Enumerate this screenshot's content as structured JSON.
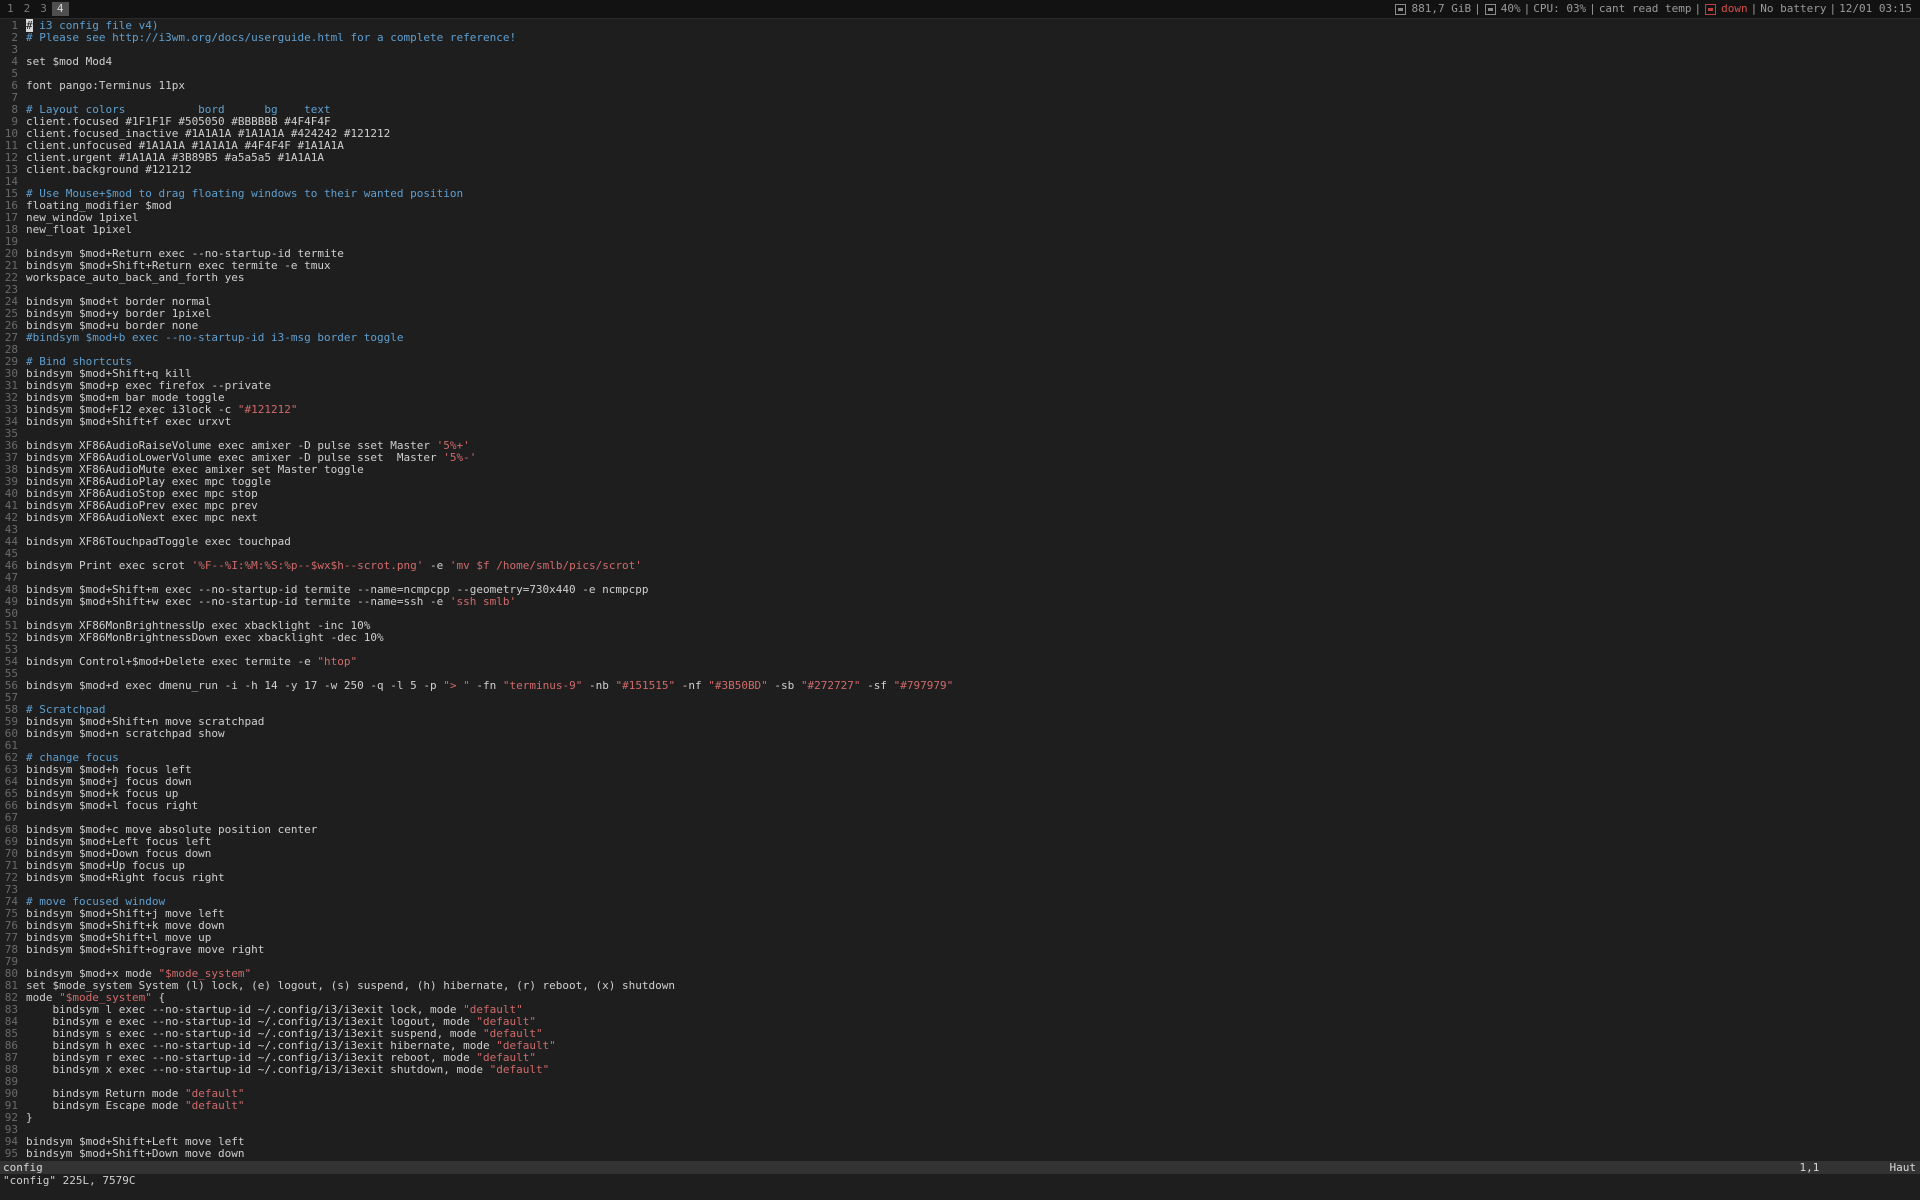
{
  "topbar": {
    "workspaces": [
      "1",
      "2",
      "3",
      "4"
    ],
    "focused_workspace": "4",
    "disk": "881,7 GiB",
    "volume": "40%",
    "cpu": "CPU: 03%",
    "temp": "cant read temp",
    "net": "down",
    "battery": "No battery",
    "datetime": "12/01 03:15",
    "icons": [
      "disk-icon",
      "volume-icon",
      "network-icon"
    ]
  },
  "editor": {
    "lines": [
      [
        {
          "t": "# i3 config file v4)",
          "c": "comment"
        }
      ],
      [
        {
          "t": "# Please see http://i3wm.org/docs/userguide.html for a complete reference!",
          "c": "comment"
        }
      ],
      [],
      [
        {
          "t": "set $mod Mod4"
        }
      ],
      [],
      [
        {
          "t": "font pango:Terminus 11px"
        }
      ],
      [],
      [
        {
          "t": "# Layout colors           bord      bg    text",
          "c": "comment"
        }
      ],
      [
        {
          "t": "client.focused #1F1F1F #505050 #BBBBBB #4F4F4F"
        }
      ],
      [
        {
          "t": "client.focused_inactive #1A1A1A #1A1A1A #424242 #121212"
        }
      ],
      [
        {
          "t": "client.unfocused #1A1A1A #1A1A1A #4F4F4F #1A1A1A"
        }
      ],
      [
        {
          "t": "client.urgent #1A1A1A #3B89B5 #a5a5a5 #1A1A1A"
        }
      ],
      [
        {
          "t": "client.background #121212"
        }
      ],
      [],
      [
        {
          "t": "# Use Mouse+$mod to drag floating windows to their wanted position",
          "c": "comment"
        }
      ],
      [
        {
          "t": "floating_modifier $mod"
        }
      ],
      [
        {
          "t": "new_window 1pixel"
        }
      ],
      [
        {
          "t": "new_float 1pixel"
        }
      ],
      [],
      [
        {
          "t": "bindsym $mod+Return exec --no-startup-id termite"
        }
      ],
      [
        {
          "t": "bindsym $mod+Shift+Return exec termite -e tmux"
        }
      ],
      [
        {
          "t": "workspace_auto_back_and_forth yes"
        }
      ],
      [],
      [
        {
          "t": "bindsym $mod+t border normal"
        }
      ],
      [
        {
          "t": "bindsym $mod+y border 1pixel"
        }
      ],
      [
        {
          "t": "bindsym $mod+u border none"
        }
      ],
      [
        {
          "t": "#bindsym $mod+b exec --no-startup-id i3-msg border toggle",
          "c": "comment"
        }
      ],
      [],
      [
        {
          "t": "# Bind shortcuts",
          "c": "comment"
        }
      ],
      [
        {
          "t": "bindsym $mod+Shift+q kill"
        }
      ],
      [
        {
          "t": "bindsym $mod+p exec firefox --private"
        }
      ],
      [
        {
          "t": "bindsym $mod+m bar mode toggle"
        }
      ],
      [
        {
          "t": "bindsym $mod+F12 exec i3lock -c "
        },
        {
          "t": "\"#121212\"",
          "c": "str"
        }
      ],
      [
        {
          "t": "bindsym $mod+Shift+f exec urxvt"
        }
      ],
      [],
      [
        {
          "t": "bindsym XF86AudioRaiseVolume exec amixer -D pulse sset Master "
        },
        {
          "t": "'5%+'",
          "c": "str"
        }
      ],
      [
        {
          "t": "bindsym XF86AudioLowerVolume exec amixer -D pulse sset  Master "
        },
        {
          "t": "'5%-'",
          "c": "str"
        }
      ],
      [
        {
          "t": "bindsym XF86AudioMute exec amixer set Master toggle"
        }
      ],
      [
        {
          "t": "bindsym XF86AudioPlay exec mpc toggle"
        }
      ],
      [
        {
          "t": "bindsym XF86AudioStop exec mpc stop"
        }
      ],
      [
        {
          "t": "bindsym XF86AudioPrev exec mpc prev"
        }
      ],
      [
        {
          "t": "bindsym XF86AudioNext exec mpc next"
        }
      ],
      [],
      [
        {
          "t": "bindsym XF86TouchpadToggle exec touchpad"
        }
      ],
      [],
      [
        {
          "t": "bindsym Print exec scrot "
        },
        {
          "t": "'%F--%I:%M:%S:%p--$wx$h--scrot.png'",
          "c": "str"
        },
        {
          "t": " -e "
        },
        {
          "t": "'mv $f /home/smlb/pics/scrot'",
          "c": "str"
        }
      ],
      [],
      [
        {
          "t": "bindsym $mod+Shift+m exec --no-startup-id termite --name=ncmpcpp --geometry=730x440 -e ncmpcpp"
        }
      ],
      [
        {
          "t": "bindsym $mod+Shift+w exec --no-startup-id termite --name=ssh -e "
        },
        {
          "t": "'ssh smlb'",
          "c": "str"
        }
      ],
      [],
      [
        {
          "t": "bindsym XF86MonBrightnessUp exec xbacklight -inc 10%"
        }
      ],
      [
        {
          "t": "bindsym XF86MonBrightnessDown exec xbacklight -dec 10%"
        }
      ],
      [],
      [
        {
          "t": "bindsym Control+$mod+Delete exec termite -e "
        },
        {
          "t": "\"htop\"",
          "c": "str"
        }
      ],
      [],
      [
        {
          "t": "bindsym $mod+d exec dmenu_run -i -h 14 -y 17 -w 250 -q -l 5 -p "
        },
        {
          "t": "\"> \"",
          "c": "str"
        },
        {
          "t": " -fn "
        },
        {
          "t": "\"terminus-9\"",
          "c": "str"
        },
        {
          "t": " -nb "
        },
        {
          "t": "\"#151515\"",
          "c": "str"
        },
        {
          "t": " -nf "
        },
        {
          "t": "\"#3B50BD\"",
          "c": "str"
        },
        {
          "t": " -sb "
        },
        {
          "t": "\"#272727\"",
          "c": "str"
        },
        {
          "t": " -sf "
        },
        {
          "t": "\"#797979\"",
          "c": "str"
        }
      ],
      [],
      [
        {
          "t": "# Scratchpad",
          "c": "comment"
        }
      ],
      [
        {
          "t": "bindsym $mod+Shift+n move scratchpad"
        }
      ],
      [
        {
          "t": "bindsym $mod+n scratchpad show"
        }
      ],
      [],
      [
        {
          "t": "# change focus",
          "c": "comment"
        }
      ],
      [
        {
          "t": "bindsym $mod+h focus left"
        }
      ],
      [
        {
          "t": "bindsym $mod+j focus down"
        }
      ],
      [
        {
          "t": "bindsym $mod+k focus up"
        }
      ],
      [
        {
          "t": "bindsym $mod+l focus right"
        }
      ],
      [],
      [
        {
          "t": "bindsym $mod+c move absolute position center"
        }
      ],
      [
        {
          "t": "bindsym $mod+Left focus left"
        }
      ],
      [
        {
          "t": "bindsym $mod+Down focus down"
        }
      ],
      [
        {
          "t": "bindsym $mod+Up focus up"
        }
      ],
      [
        {
          "t": "bindsym $mod+Right focus right"
        }
      ],
      [],
      [
        {
          "t": "# move focused window",
          "c": "comment"
        }
      ],
      [
        {
          "t": "bindsym $mod+Shift+j move left"
        }
      ],
      [
        {
          "t": "bindsym $mod+Shift+k move down"
        }
      ],
      [
        {
          "t": "bindsym $mod+Shift+l move up"
        }
      ],
      [
        {
          "t": "bindsym $mod+Shift+ograve move right"
        }
      ],
      [],
      [
        {
          "t": "bindsym $mod+x mode "
        },
        {
          "t": "\"$mode_system\"",
          "c": "str"
        }
      ],
      [
        {
          "t": "set $mode_system System (l) lock, (e) logout, (s) suspend, (h) hibernate, (r) reboot, (x) shutdown"
        }
      ],
      [
        {
          "t": "mode "
        },
        {
          "t": "\"$mode_system\"",
          "c": "str"
        },
        {
          "t": " {"
        }
      ],
      [
        {
          "t": "    bindsym l exec --no-startup-id ~/.config/i3/i3exit lock, mode "
        },
        {
          "t": "\"default\"",
          "c": "str"
        }
      ],
      [
        {
          "t": "    bindsym e exec --no-startup-id ~/.config/i3/i3exit logout, mode "
        },
        {
          "t": "\"default\"",
          "c": "str"
        }
      ],
      [
        {
          "t": "    bindsym s exec --no-startup-id ~/.config/i3/i3exit suspend, mode "
        },
        {
          "t": "\"default\"",
          "c": "str"
        }
      ],
      [
        {
          "t": "    bindsym h exec --no-startup-id ~/.config/i3/i3exit hibernate, mode "
        },
        {
          "t": "\"default\"",
          "c": "str"
        }
      ],
      [
        {
          "t": "    bindsym r exec --no-startup-id ~/.config/i3/i3exit reboot, mode "
        },
        {
          "t": "\"default\"",
          "c": "str"
        }
      ],
      [
        {
          "t": "    bindsym x exec --no-startup-id ~/.config/i3/i3exit shutdown, mode "
        },
        {
          "t": "\"default\"",
          "c": "str"
        }
      ],
      [],
      [
        {
          "t": "    bindsym Return mode "
        },
        {
          "t": "\"default\"",
          "c": "str"
        }
      ],
      [
        {
          "t": "    bindsym Escape mode "
        },
        {
          "t": "\"default\"",
          "c": "str"
        }
      ],
      [
        {
          "t": "}"
        }
      ],
      [],
      [
        {
          "t": "bindsym $mod+Shift+Left move left"
        }
      ],
      [
        {
          "t": "bindsym $mod+Shift+Down move down"
        }
      ]
    ]
  },
  "statusline": {
    "filename": "config",
    "position": "1,1",
    "scroll": "Haut"
  },
  "cmdline": {
    "message": "\"config\" 225L, 7579C"
  },
  "colors": {
    "background": "#1e1e1e",
    "comment": "#5f9fcf",
    "string": "#d06a6a",
    "focused_workspace": "#4F4F4F",
    "net_down": "#d05050"
  }
}
